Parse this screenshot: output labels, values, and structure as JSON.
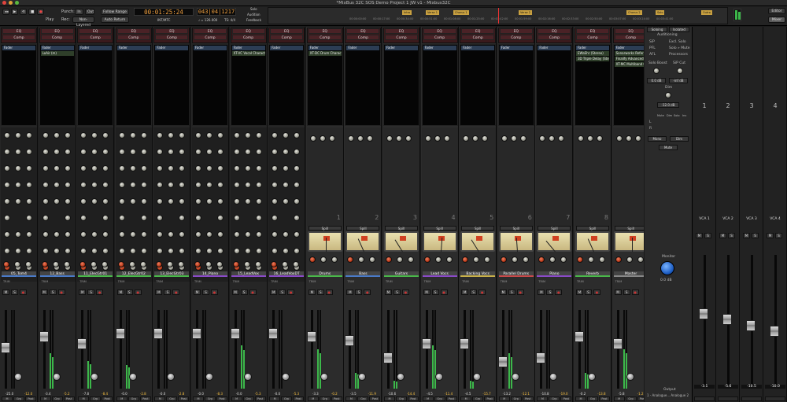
{
  "window": {
    "title": "*MixBus 32C SOS Demo Project 1 JW v1 - Mixbus32C"
  },
  "toolbar": {
    "punch_label": "Punch:",
    "in_label": "In",
    "out_label": "Out",
    "rec_label": "Rec:",
    "nonlayered_label": "Non-Layered",
    "follow_range": "Follow Range",
    "auto_return": "Auto Return",
    "play_label": "Play",
    "primary_clock": "00:01:25:24",
    "secondary_clock": "043|04|1217",
    "int_mtc": "INT/MTC",
    "tempo": "♩ = 126.000",
    "meter": "TS: 4/4",
    "solo_label": "Solo",
    "audition_label": "Audition",
    "feedback_label": "Feedback",
    "editor_button": "Editor",
    "mixer_button": "Mixer"
  },
  "timeline": {
    "ticks": [
      "00:00:00:00",
      "00:00:17:00",
      "00:00:34:00",
      "00:00:51:00",
      "00:01:08:00",
      "00:01:25:00",
      "00:01:42:00",
      "00:01:59:00",
      "00:02:16:00",
      "00:02:33:00",
      "00:02:50:00",
      "00:03:07:00",
      "00:03:24:00",
      "00:03:41:00"
    ],
    "markers": [
      "Intro",
      "Verse 1",
      "Chorus 1",
      "Verse 2",
      "Chorus 2",
      "Solo",
      "Outro"
    ]
  },
  "strips": [
    {
      "name": "05_Tom4",
      "type": "track",
      "plugins": [
        "Fader"
      ],
      "color": "#4a7ac8",
      "gain": "-25.0",
      "peak": "-12.0",
      "fader": 0.55,
      "meter": 0.0
    },
    {
      "name": "12_Bass",
      "type": "track",
      "plugins": [
        "Fader",
        "LoAir (m)"
      ],
      "color": "#4a7ac8",
      "gain": "-3.4",
      "peak": "-5.2",
      "fader": 0.7,
      "meter": 0.45
    },
    {
      "name": "11_ElecGtr01",
      "type": "track",
      "plugins": [
        "Fader"
      ],
      "color": "#4ab84a",
      "gain": "-7.8",
      "peak": "-8.4",
      "fader": 0.6,
      "meter": 0.35
    },
    {
      "name": "12_ElecGtr02",
      "type": "track",
      "plugins": [
        "Fader"
      ],
      "color": "#4ab84a",
      "gain": "-0.0",
      "peak": "-2.8",
      "fader": 0.75,
      "meter": 0.3
    },
    {
      "name": "13_ElecGtr03",
      "type": "track",
      "plugins": [
        "Fader"
      ],
      "color": "#4ab84a",
      "gain": "-0.0",
      "peak": "-2.8",
      "fader": 0.75,
      "meter": 0.0
    },
    {
      "name": "14_Piano",
      "type": "track",
      "plugins": [
        "Fader"
      ],
      "color": "#8a4ac8",
      "gain": "-0.0",
      "peak": "-8.3",
      "fader": 0.75,
      "meter": 0.0
    },
    {
      "name": "15_LeadVox",
      "type": "track",
      "plugins": [
        "Fader",
        "XT-VC Vocal Charact"
      ],
      "color": "#8a4ac8",
      "gain": "-0.0",
      "peak": "-5.3",
      "fader": 0.75,
      "meter": 0.55
    },
    {
      "name": "16_LeadVoxDT",
      "type": "track",
      "plugins": [
        "Fader"
      ],
      "color": "#8a4ac8",
      "gain": "-0.0",
      "peak": "-5.3",
      "fader": 0.75,
      "meter": 0.0
    },
    {
      "name": "Drums",
      "type": "bus",
      "bus_number": "1",
      "plugins": [
        "Fader",
        "XT-DC Drum Charact"
      ],
      "color": "#4ab84a",
      "gain": "-3.3",
      "peak": "-0.2",
      "fader": 0.7,
      "meter": 0.5
    },
    {
      "name": "Bass",
      "type": "bus",
      "bus_number": "2",
      "plugins": [
        "Fader"
      ],
      "color": "#4a7ac8",
      "gain": "-3.5",
      "peak": "-11.9",
      "fader": 0.65,
      "meter": 0.2
    },
    {
      "name": "Guitars",
      "type": "bus",
      "bus_number": "3",
      "plugins": [
        "Fader"
      ],
      "color": "#4ab84a",
      "gain": "-10.6",
      "peak": "-14.4",
      "fader": 0.4,
      "meter": 0.1
    },
    {
      "name": "Lead Vocs",
      "type": "bus",
      "bus_number": "4",
      "plugins": [
        "Fader"
      ],
      "color": "#8a4ac8",
      "gain": "-4.5",
      "peak": "-11.4",
      "fader": 0.6,
      "meter": 0.55
    },
    {
      "name": "Backing Vocs",
      "type": "bus",
      "bus_number": "5",
      "plugins": [
        "Fader"
      ],
      "color": "#c8b04a",
      "gain": "-4.5",
      "peak": "-15.7",
      "fader": 0.6,
      "meter": 0.1
    },
    {
      "name": "Parallel Drums",
      "type": "bus",
      "bus_number": "6",
      "plugins": [
        "Fader"
      ],
      "color": "#c84a4a",
      "gain": "-13.2",
      "peak": "-12.1",
      "fader": 0.35,
      "meter": 0.45
    },
    {
      "name": "Piano",
      "type": "bus",
      "bus_number": "7",
      "plugins": [
        "Fader"
      ],
      "color": "#8a4ac8",
      "gain": "-10.8",
      "peak": "-19.0",
      "fader": 0.4,
      "meter": 0.0
    },
    {
      "name": "Reverb",
      "type": "bus",
      "bus_number": "8",
      "plugins": [
        "Fader",
        "EWaShr (Stereo)",
        "3D Triple Delay (Ster"
      ],
      "color": "#4ab84a",
      "gain": "-0.2",
      "peak": "-13.8",
      "fader": 0.7,
      "meter": 0.2
    },
    {
      "name": "Master",
      "type": "master",
      "plugins": [
        "Fader",
        "Sonarworks Referen",
        "Finalify Advanced",
        "XT-MC Multiband Co"
      ],
      "color": "#888888",
      "gain": "-5.8",
      "peak": "-1.2",
      "fader": 0.6,
      "meter": 0.5
    }
  ],
  "monitor": {
    "soloing_label": "Soloing",
    "isolated_label": "Isolated",
    "auditioning_label": "Auditioning",
    "sip_label": "SiP",
    "excl_solo_label": "Excl. Solo",
    "pfl_label": "PFL",
    "solo_mute_label": "Solo » Mute",
    "afl_label": "AFL",
    "processors_label": "Processors",
    "solo_boost_label": "Solo Boost",
    "sip_cut_label": "SiP Cut",
    "solo_boost_value": "0.0 dB",
    "sip_cut_value": "-inf dB",
    "dim_label": "Dim",
    "dim_value": "-12.0 dB",
    "mute_label": "Mute",
    "solo_label": "Solo",
    "inv_label": "Inv",
    "l_label": "L",
    "r_label": "R",
    "mono_button": "Mono",
    "dim_button": "Dim",
    "mute_button": "Mute",
    "monitor_label": "Monitor",
    "monitor_value": "0.0 dB",
    "output_label": "Output",
    "output_value": "1 - Analogue... Analogue 2"
  },
  "vcas": [
    {
      "number": "1",
      "name": "VCA 1",
      "value": "-3.1",
      "fader": 0.55
    },
    {
      "number": "2",
      "name": "VCA 2",
      "value": "-5.6",
      "fader": 0.5
    },
    {
      "number": "3",
      "name": "VCA 3",
      "value": "-10.5",
      "fader": 0.45
    },
    {
      "number": "4",
      "name": "VCA 4",
      "value": "-10.0",
      "fader": 0.4
    }
  ],
  "common": {
    "eq": "EQ",
    "comp": "Comp",
    "spill": "Spill",
    "m": "M",
    "s": "S",
    "grp": "Grp",
    "post": "Post",
    "trim": "TRIM",
    "compr": "Compre",
    "leveler": "Leveler"
  }
}
